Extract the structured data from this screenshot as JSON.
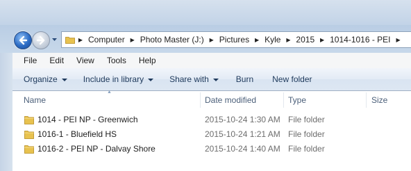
{
  "address": {
    "crumbs": [
      "Computer",
      "Photo Master (J:)",
      "Pictures",
      "Kyle",
      "2015",
      "1014-1016 - PEI"
    ]
  },
  "menu": [
    "File",
    "Edit",
    "View",
    "Tools",
    "Help"
  ],
  "toolbar": {
    "organize": "Organize",
    "include": "Include in library",
    "share": "Share with",
    "burn": "Burn",
    "new_folder": "New folder"
  },
  "columns": {
    "name": "Name",
    "date": "Date modified",
    "type": "Type",
    "size": "Size"
  },
  "files": [
    {
      "name": "1014 - PEI NP - Greenwich",
      "date": "2015-10-24 1:30 AM",
      "type": "File folder",
      "size": ""
    },
    {
      "name": "1016-1 - Bluefield HS",
      "date": "2015-10-24 1:21 AM",
      "type": "File folder",
      "size": ""
    },
    {
      "name": "1016-2 - PEI NP - Dalvay Shore",
      "date": "2015-10-24 1:40 AM",
      "type": "File folder",
      "size": ""
    }
  ],
  "colors": {
    "chrome": "#c2d3e7",
    "command_text": "#1e395b",
    "header_text": "#4c607a",
    "muted_text": "#6d6d6d",
    "folder": "#e8c24f"
  }
}
